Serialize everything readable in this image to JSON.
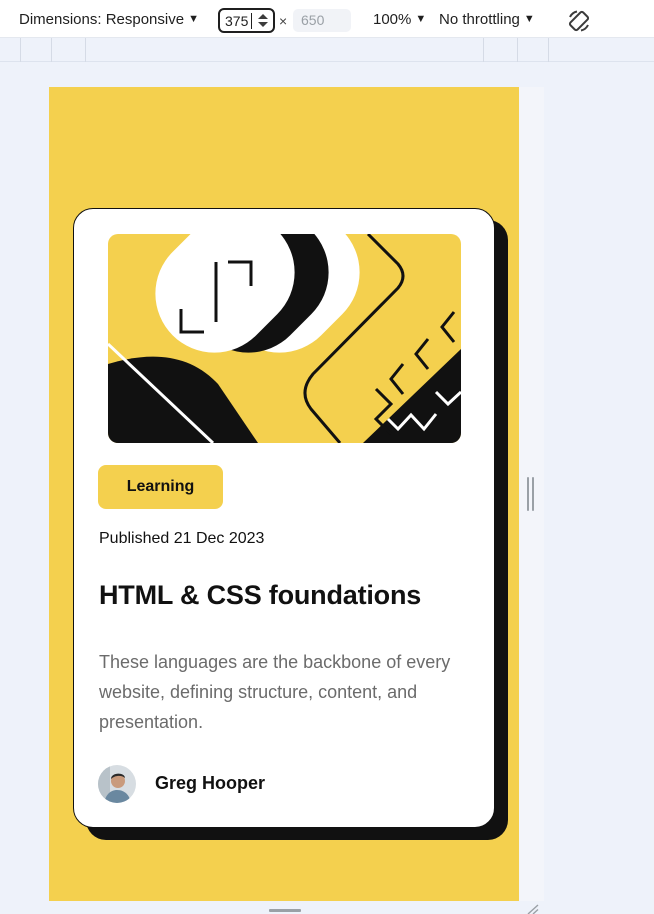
{
  "devtools": {
    "dimensions_label": "Dimensions: Responsive",
    "width_value": "375",
    "times_symbol": "×",
    "height_placeholder": "650",
    "zoom_label": "100%",
    "throttling_label": "No throttling",
    "dropdown_caret": "▼",
    "icons": {
      "spinner": "spin-arrows-icon",
      "rotate": "rotate-icon"
    }
  },
  "card": {
    "tag": "Learning",
    "published": "Published 21 Dec 2023",
    "title": "HTML & CSS foundations",
    "description": "These languages are the backbone of every website, defining structure, content, and presentation.",
    "author": "Greg Hooper"
  },
  "colors": {
    "accent_yellow": "#f4d04e",
    "ink": "#111111",
    "muted_text": "#6b6b6b"
  }
}
